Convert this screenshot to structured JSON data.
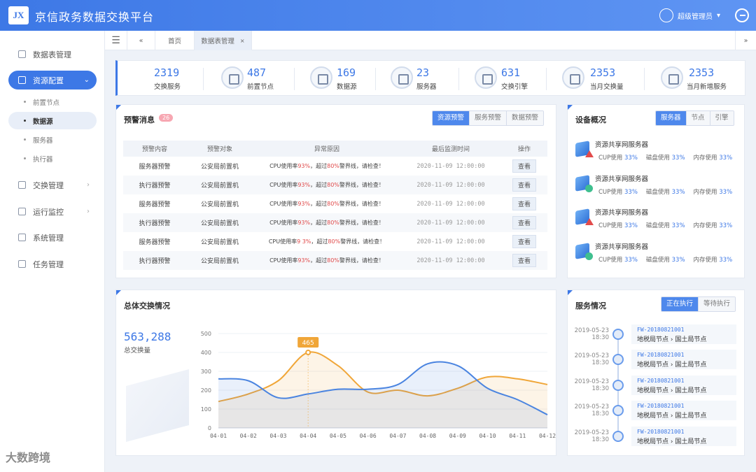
{
  "app": {
    "logo_text": "JX",
    "title": "京信政务数据交换平台",
    "user": "超级管理员"
  },
  "sidebar": {
    "items": [
      {
        "label": "数据表管理",
        "icon": "table-icon"
      },
      {
        "label": "资源配置",
        "icon": "config-icon",
        "active": true,
        "expanded": true
      },
      {
        "label": "交换管理",
        "icon": "exchange-icon"
      },
      {
        "label": "运行监控",
        "icon": "monitor-icon"
      },
      {
        "label": "系统管理",
        "icon": "system-icon"
      },
      {
        "label": "任务管理",
        "icon": "task-icon"
      }
    ],
    "subitems": [
      "前置节点",
      "数据源",
      "服务器",
      "执行器"
    ],
    "active_sub": "数据源"
  },
  "tabs": {
    "home": "首页",
    "current": "数据表管理"
  },
  "stats": [
    {
      "value": "2319",
      "label": "交换服务",
      "icon": "service-icon"
    },
    {
      "value": "487",
      "label": "前置节点",
      "icon": "router-icon"
    },
    {
      "value": "169",
      "label": "数据源",
      "icon": "database-icon"
    },
    {
      "value": "23",
      "label": "服务器",
      "icon": "server-icon"
    },
    {
      "value": "631",
      "label": "交换引擎",
      "icon": "engine-icon"
    },
    {
      "value": "2353",
      "label": "当月交换量",
      "icon": "volume-icon"
    },
    {
      "value": "2353",
      "label": "当月新增服务",
      "icon": "new-service-icon"
    }
  ],
  "alerts": {
    "title": "预警消息",
    "count": "26",
    "tabs": [
      "资源预警",
      "服务预警",
      "数据预警"
    ],
    "headers": [
      "预警内容",
      "预警对象",
      "异常原因",
      "最后监测时间",
      "操作"
    ],
    "rows": [
      {
        "content": "服务器预警",
        "object": "公安局前置机",
        "r1": "CPU使用率",
        "v1": "93%",
        "r2": "，超过",
        "v2": "80%",
        "r3": "警界线，请检查！",
        "time": "2020-11-09 12:00:00",
        "action": "查看"
      },
      {
        "content": "执行器预警",
        "object": "公安局前置机",
        "r1": "CPU使用率",
        "v1": "93%",
        "r2": "，超过",
        "v2": "80%",
        "r3": "警界线，请检查！",
        "time": "2020-11-09 12:00:00",
        "action": "查看"
      },
      {
        "content": "服务器预警",
        "object": "公安局前置机",
        "r1": "CPU使用率",
        "v1": "93%",
        "r2": "，超过",
        "v2": "80%",
        "r3": "警界线，请检查！",
        "time": "2020-11-09 12:00:00",
        "action": "查看"
      },
      {
        "content": "执行器预警",
        "object": "公安局前置机",
        "r1": "CPU使用率",
        "v1": "93%",
        "r2": "，超过",
        "v2": "80%",
        "r3": "警界线，请检查！",
        "time": "2020-11-09 12:00:00",
        "action": "查看"
      },
      {
        "content": "服务器预警",
        "object": "公安局前置机",
        "r1": "CPU使用率",
        "v1": "9 3%",
        "r2": "，超过",
        "v2": "80%",
        "r3": "警界线，请检查！",
        "time": "2020-11-09 12:00:00",
        "action": "查看"
      },
      {
        "content": "执行器预警",
        "object": "公安局前置机",
        "r1": "CPU使用率",
        "v1": "93%",
        "r2": "，超过",
        "v2": "80%",
        "r3": "警界线，请检查！",
        "time": "2020-11-09 12:00:00",
        "action": "查看"
      }
    ]
  },
  "devices": {
    "title": "设备概况",
    "tabs": [
      "服务器",
      "节点",
      "引擎"
    ],
    "items": [
      {
        "name": "资源共享网服务器",
        "status": "warning",
        "cpu_label": "CUP使用",
        "cpu": "33%",
        "disk_label": "磁盘使用",
        "disk": "33%",
        "mem_label": "内存使用",
        "mem": "33%"
      },
      {
        "name": "资源共享网服务器",
        "status": "ok",
        "cpu_label": "CUP使用",
        "cpu": "33%",
        "disk_label": "磁盘使用",
        "disk": "33%",
        "mem_label": "内存使用",
        "mem": "33%"
      },
      {
        "name": "资源共享网服务器",
        "status": "warning",
        "cpu_label": "CUP使用",
        "cpu": "33%",
        "disk_label": "磁盘使用",
        "disk": "33%",
        "mem_label": "内存使用",
        "mem": "33%"
      },
      {
        "name": "资源共享网服务器",
        "status": "ok",
        "cpu_label": "CUP使用",
        "cpu": "33%",
        "disk_label": "磁盘使用",
        "disk": "33%",
        "mem_label": "内存使用",
        "mem": "33%"
      }
    ]
  },
  "exchange": {
    "title": "总体交换情况",
    "total": "563,288",
    "total_label": "总交换量"
  },
  "chart_data": {
    "type": "line",
    "categories": [
      "04-01",
      "04-02",
      "04-03",
      "04-04",
      "04-05",
      "04-06",
      "04-07",
      "04-08",
      "04-09",
      "04-10",
      "04-11",
      "04-12"
    ],
    "series": [
      {
        "values": [
          140,
          180,
          250,
          400,
          330,
          190,
          200,
          170,
          210,
          270,
          260,
          230
        ],
        "color": "#f0a638"
      },
      {
        "values": [
          260,
          250,
          160,
          180,
          205,
          205,
          230,
          340,
          330,
          210,
          150,
          70
        ],
        "color": "#4a84e0"
      }
    ],
    "ylim": [
      0,
      500
    ],
    "yticks": [
      0,
      100,
      200,
      300,
      400,
      500
    ],
    "annotation": {
      "x": "04-04",
      "value": "465"
    }
  },
  "services": {
    "title": "服务情况",
    "tabs": [
      "正在执行",
      "等待执行"
    ],
    "items": [
      {
        "date": "2019-05-23",
        "time": "18:30",
        "code": "FW-20180821001",
        "from": "地税局节点",
        "to": "国土局节点"
      },
      {
        "date": "2019-05-23",
        "time": "18:30",
        "code": "FW-20180821001",
        "from": "地税局节点",
        "to": "国土局节点"
      },
      {
        "date": "2019-05-23",
        "time": "18:30",
        "code": "FW-20180821001",
        "from": "地税局节点",
        "to": "国土局节点"
      },
      {
        "date": "2019-05-23",
        "time": "18:30",
        "code": "FW-20180821001",
        "from": "地税局节点",
        "to": "国土局节点"
      },
      {
        "date": "2019-05-23",
        "time": "18:30",
        "code": "FW-20180821001",
        "from": "地税局节点",
        "to": "国土局节点"
      }
    ]
  },
  "watermark": "大数跨境"
}
